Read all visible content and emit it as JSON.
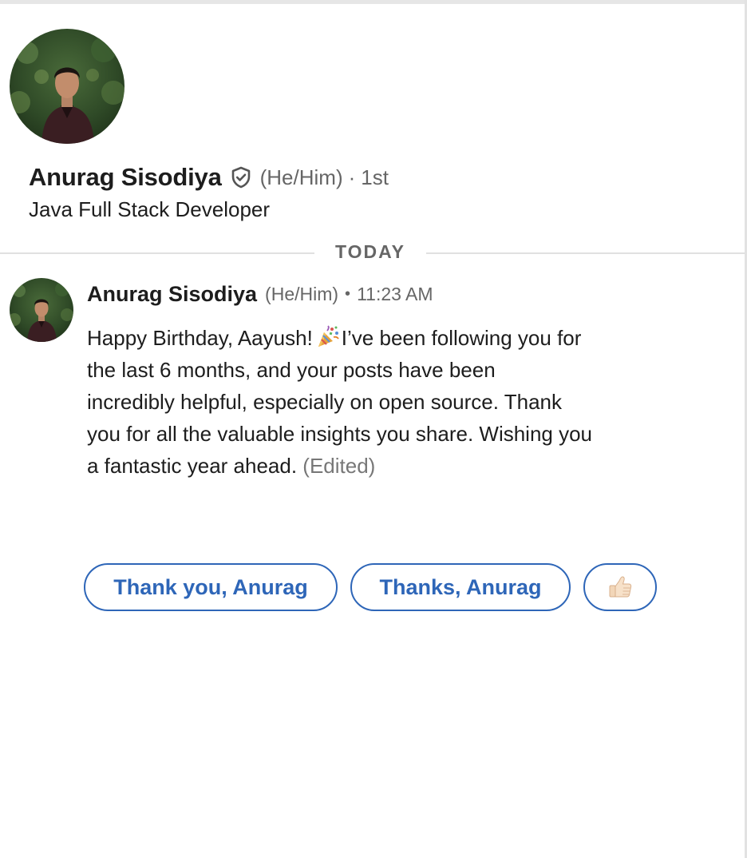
{
  "profile": {
    "name": "Anurag Sisodiya",
    "pronouns": "(He/Him)",
    "separator": "·",
    "connection_degree": "1st",
    "headline": "Java Full Stack Developer",
    "avatar_icon": "profile-photo",
    "verified_icon": "verified-shield-icon"
  },
  "divider": {
    "label": "TODAY"
  },
  "message": {
    "sender": "Anurag Sisodiya",
    "pronouns": "(He/Him)",
    "separator": "•",
    "time": "11:23 AM",
    "lines": [
      "Happy Birthday, Aayush!",
      "I’ve been following you for",
      "the last 6 months, and your posts have been",
      "incredibly helpful, especially on open source. Thank",
      "you for all the valuable insights you share. Wishing you",
      "a fantastic year ahead."
    ],
    "edited_label": "(Edited)",
    "inline_icon": "party-popper-icon"
  },
  "quick_replies": [
    {
      "label": "Thank you, Anurag"
    },
    {
      "label": "Thanks, Anurag"
    },
    {
      "icon": "thumbs-up-icon"
    }
  ],
  "colors": {
    "accent_blue": "#2e66b8",
    "text_primary": "#1d1d1d",
    "text_secondary": "#666666",
    "divider": "#e0e0e0"
  }
}
